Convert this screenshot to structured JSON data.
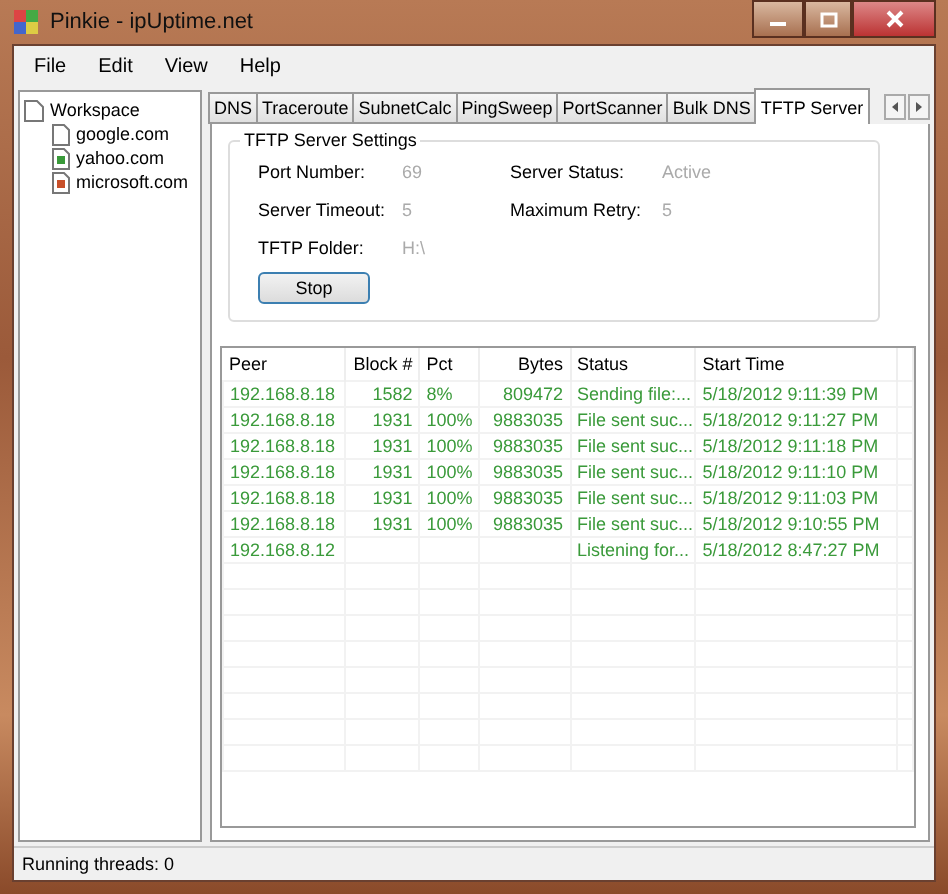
{
  "window": {
    "title": "Pinkie - ipUptime.net"
  },
  "menu": [
    "File",
    "Edit",
    "View",
    "Help"
  ],
  "tree": [
    {
      "label": "Workspace",
      "children": [
        {
          "label": "google.com",
          "kind": "blank"
        },
        {
          "label": "yahoo.com",
          "kind": "green"
        },
        {
          "label": "microsoft.com",
          "kind": "orange"
        }
      ]
    }
  ],
  "tabs": [
    {
      "label": "DNS",
      "selected": false
    },
    {
      "label": "Traceroute",
      "selected": false
    },
    {
      "label": "SubnetCalc",
      "selected": false
    },
    {
      "label": "PingSweep",
      "selected": false
    },
    {
      "label": "PortScanner",
      "selected": false
    },
    {
      "label": "Bulk DNS",
      "selected": false
    },
    {
      "label": "TFTP Server",
      "selected": true
    }
  ],
  "settings": {
    "title": "TFTP Server Settings",
    "fields": [
      {
        "label": "Port Number:",
        "value": "69"
      },
      {
        "label": "Server Status:",
        "value": "Active"
      },
      {
        "label": "Server Timeout:",
        "value": "5"
      },
      {
        "label": "Maximum Retry:",
        "value": "5"
      },
      {
        "label": "TFTP Folder:",
        "value": "H:\\"
      }
    ],
    "button": "Stop"
  },
  "table": {
    "columns": [
      "Peer",
      "Block #",
      "Pct",
      "Bytes",
      "Status",
      "Start Time"
    ],
    "rows": [
      [
        "192.168.8.18",
        "1582",
        "8%",
        "809472",
        "Sending file:...",
        "5/18/2012 9:11:39 PM"
      ],
      [
        "192.168.8.18",
        "1931",
        "100%",
        "9883035",
        "File sent suc...",
        "5/18/2012 9:11:27 PM"
      ],
      [
        "192.168.8.18",
        "1931",
        "100%",
        "9883035",
        "File sent suc...",
        "5/18/2012 9:11:18 PM"
      ],
      [
        "192.168.8.18",
        "1931",
        "100%",
        "9883035",
        "File sent suc...",
        "5/18/2012 9:11:10 PM"
      ],
      [
        "192.168.8.18",
        "1931",
        "100%",
        "9883035",
        "File sent suc...",
        "5/18/2012 9:11:03 PM"
      ],
      [
        "192.168.8.18",
        "1931",
        "100%",
        "9883035",
        "File sent suc...",
        "5/18/2012 9:10:55 PM"
      ],
      [
        "192.168.8.12",
        "",
        "",
        "",
        "Listening for...",
        "5/18/2012 8:47:27 PM"
      ]
    ]
  },
  "status_bar": "Running threads: 0"
}
